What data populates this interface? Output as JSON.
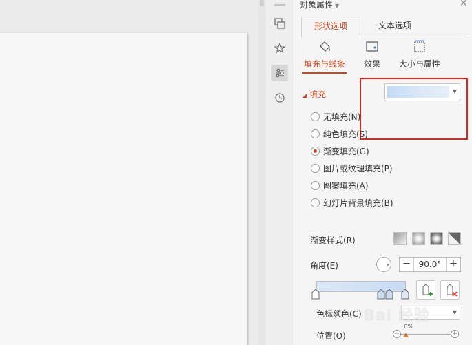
{
  "panel": {
    "title": "对象属性",
    "tabs": [
      "形状选项",
      "文本选项"
    ],
    "subtabs": [
      "填充与线条",
      "效果",
      "大小与属性"
    ]
  },
  "fill": {
    "header": "填充",
    "options": [
      {
        "label": "无填充(N)",
        "checked": false
      },
      {
        "label": "纯色填充(S)",
        "checked": false
      },
      {
        "label": "渐变填充(G)",
        "checked": true
      },
      {
        "label": "图片或纹理填充(P)",
        "checked": false
      },
      {
        "label": "图案填充(A)",
        "checked": false
      },
      {
        "label": "幻灯片背景填充(B)",
        "checked": false
      }
    ]
  },
  "gradient": {
    "style_label": "渐变样式(R)",
    "angle_label": "角度(E)",
    "angle_value": "90.0°",
    "color_label": "色标颜色(C)",
    "position_label": "位置(O)",
    "position_value": "0%"
  },
  "watermark": "Bai 经验",
  "colors": {
    "accent": "#c9471c",
    "highlight_box": "#e0241b",
    "fill_preview": "#c3daf5"
  }
}
